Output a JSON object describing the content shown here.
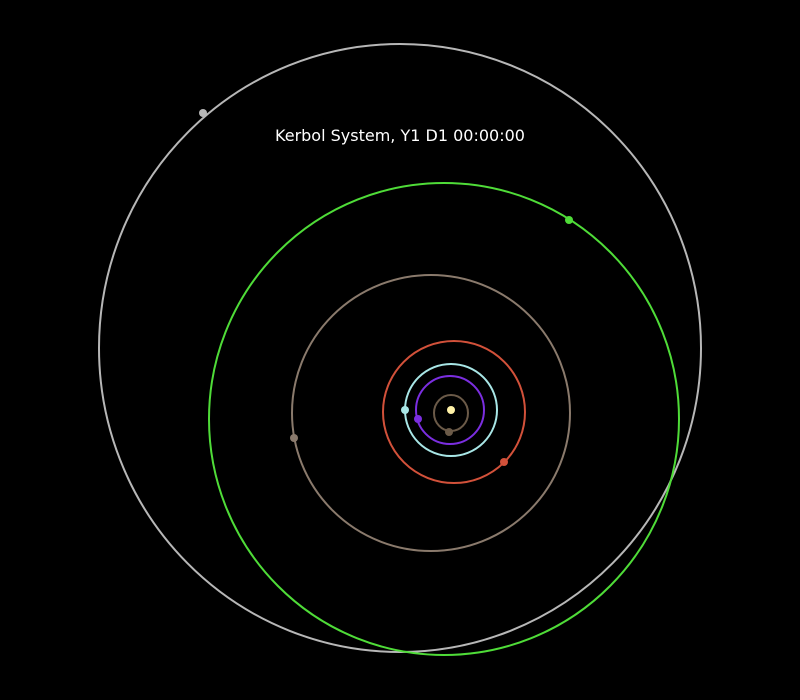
{
  "title": "Kerbol System, Y1 D1 00:00:00",
  "colors": {
    "background": "#000000",
    "title": "#ffffff",
    "sun": "#fff2a8"
  },
  "bodies": [
    {
      "id": "moho",
      "color": "#6b5a48"
    },
    {
      "id": "eve",
      "color": "#7b2ee0"
    },
    {
      "id": "kerbin",
      "color": "#a8e6e6"
    },
    {
      "id": "duna",
      "color": "#d2513a"
    },
    {
      "id": "dres",
      "color": "#8a7a6c"
    },
    {
      "id": "jool",
      "color": "#4fdc38"
    },
    {
      "id": "eeloo",
      "color": "#b7b7b7"
    }
  ]
}
